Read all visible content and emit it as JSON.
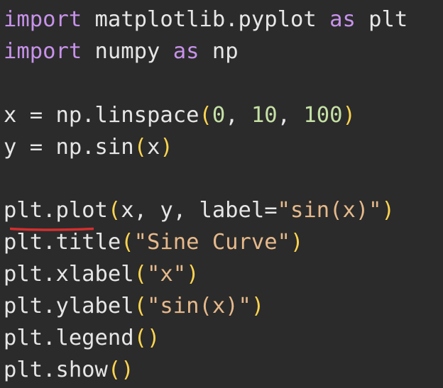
{
  "code": {
    "lines": [
      [
        {
          "t": "import",
          "c": "kw"
        },
        {
          "t": " matplotlib.pyplot ",
          "c": "txt"
        },
        {
          "t": "as",
          "c": "kw"
        },
        {
          "t": " plt",
          "c": "txt"
        }
      ],
      [
        {
          "t": "import",
          "c": "kw"
        },
        {
          "t": " numpy ",
          "c": "txt"
        },
        {
          "t": "as",
          "c": "kw"
        },
        {
          "t": " np",
          "c": "txt"
        }
      ],
      [],
      [
        {
          "t": "x = np.linspace",
          "c": "txt"
        },
        {
          "t": "(",
          "c": "paren"
        },
        {
          "t": "0",
          "c": "num"
        },
        {
          "t": ", ",
          "c": "txt"
        },
        {
          "t": "10",
          "c": "num"
        },
        {
          "t": ", ",
          "c": "txt"
        },
        {
          "t": "100",
          "c": "num"
        },
        {
          "t": ")",
          "c": "paren"
        }
      ],
      [
        {
          "t": "y = np.sin",
          "c": "txt"
        },
        {
          "t": "(",
          "c": "paren"
        },
        {
          "t": "x",
          "c": "txt"
        },
        {
          "t": ")",
          "c": "paren"
        }
      ],
      [],
      [
        {
          "t": "plt.plot",
          "c": "txt"
        },
        {
          "t": "(",
          "c": "paren"
        },
        {
          "t": "x, y, label=",
          "c": "txt"
        },
        {
          "t": "\"sin(x)\"",
          "c": "str"
        },
        {
          "t": ")",
          "c": "paren"
        }
      ],
      [
        {
          "t": "plt.title",
          "c": "txt"
        },
        {
          "t": "(",
          "c": "paren"
        },
        {
          "t": "\"Sine Curve\"",
          "c": "str"
        },
        {
          "t": ")",
          "c": "paren"
        }
      ],
      [
        {
          "t": "plt.xlabel",
          "c": "txt"
        },
        {
          "t": "(",
          "c": "paren"
        },
        {
          "t": "\"x\"",
          "c": "str"
        },
        {
          "t": ")",
          "c": "paren"
        }
      ],
      [
        {
          "t": "plt.ylabel",
          "c": "txt"
        },
        {
          "t": "(",
          "c": "paren"
        },
        {
          "t": "\"sin(x)\"",
          "c": "str"
        },
        {
          "t": ")",
          "c": "paren"
        }
      ],
      [
        {
          "t": "plt.legend",
          "c": "txt"
        },
        {
          "t": "()",
          "c": "paren"
        }
      ],
      [
        {
          "t": "plt.show",
          "c": "txt"
        },
        {
          "t": "()",
          "c": "paren"
        }
      ]
    ]
  },
  "colors": {
    "background": "#2b2b2b",
    "keyword": "#c792ea",
    "text": "#e6e6e6",
    "paren": "#ffd54f",
    "number": "#c5e1a5",
    "string": "#e6b98b",
    "annotation": "#d32f2f"
  }
}
